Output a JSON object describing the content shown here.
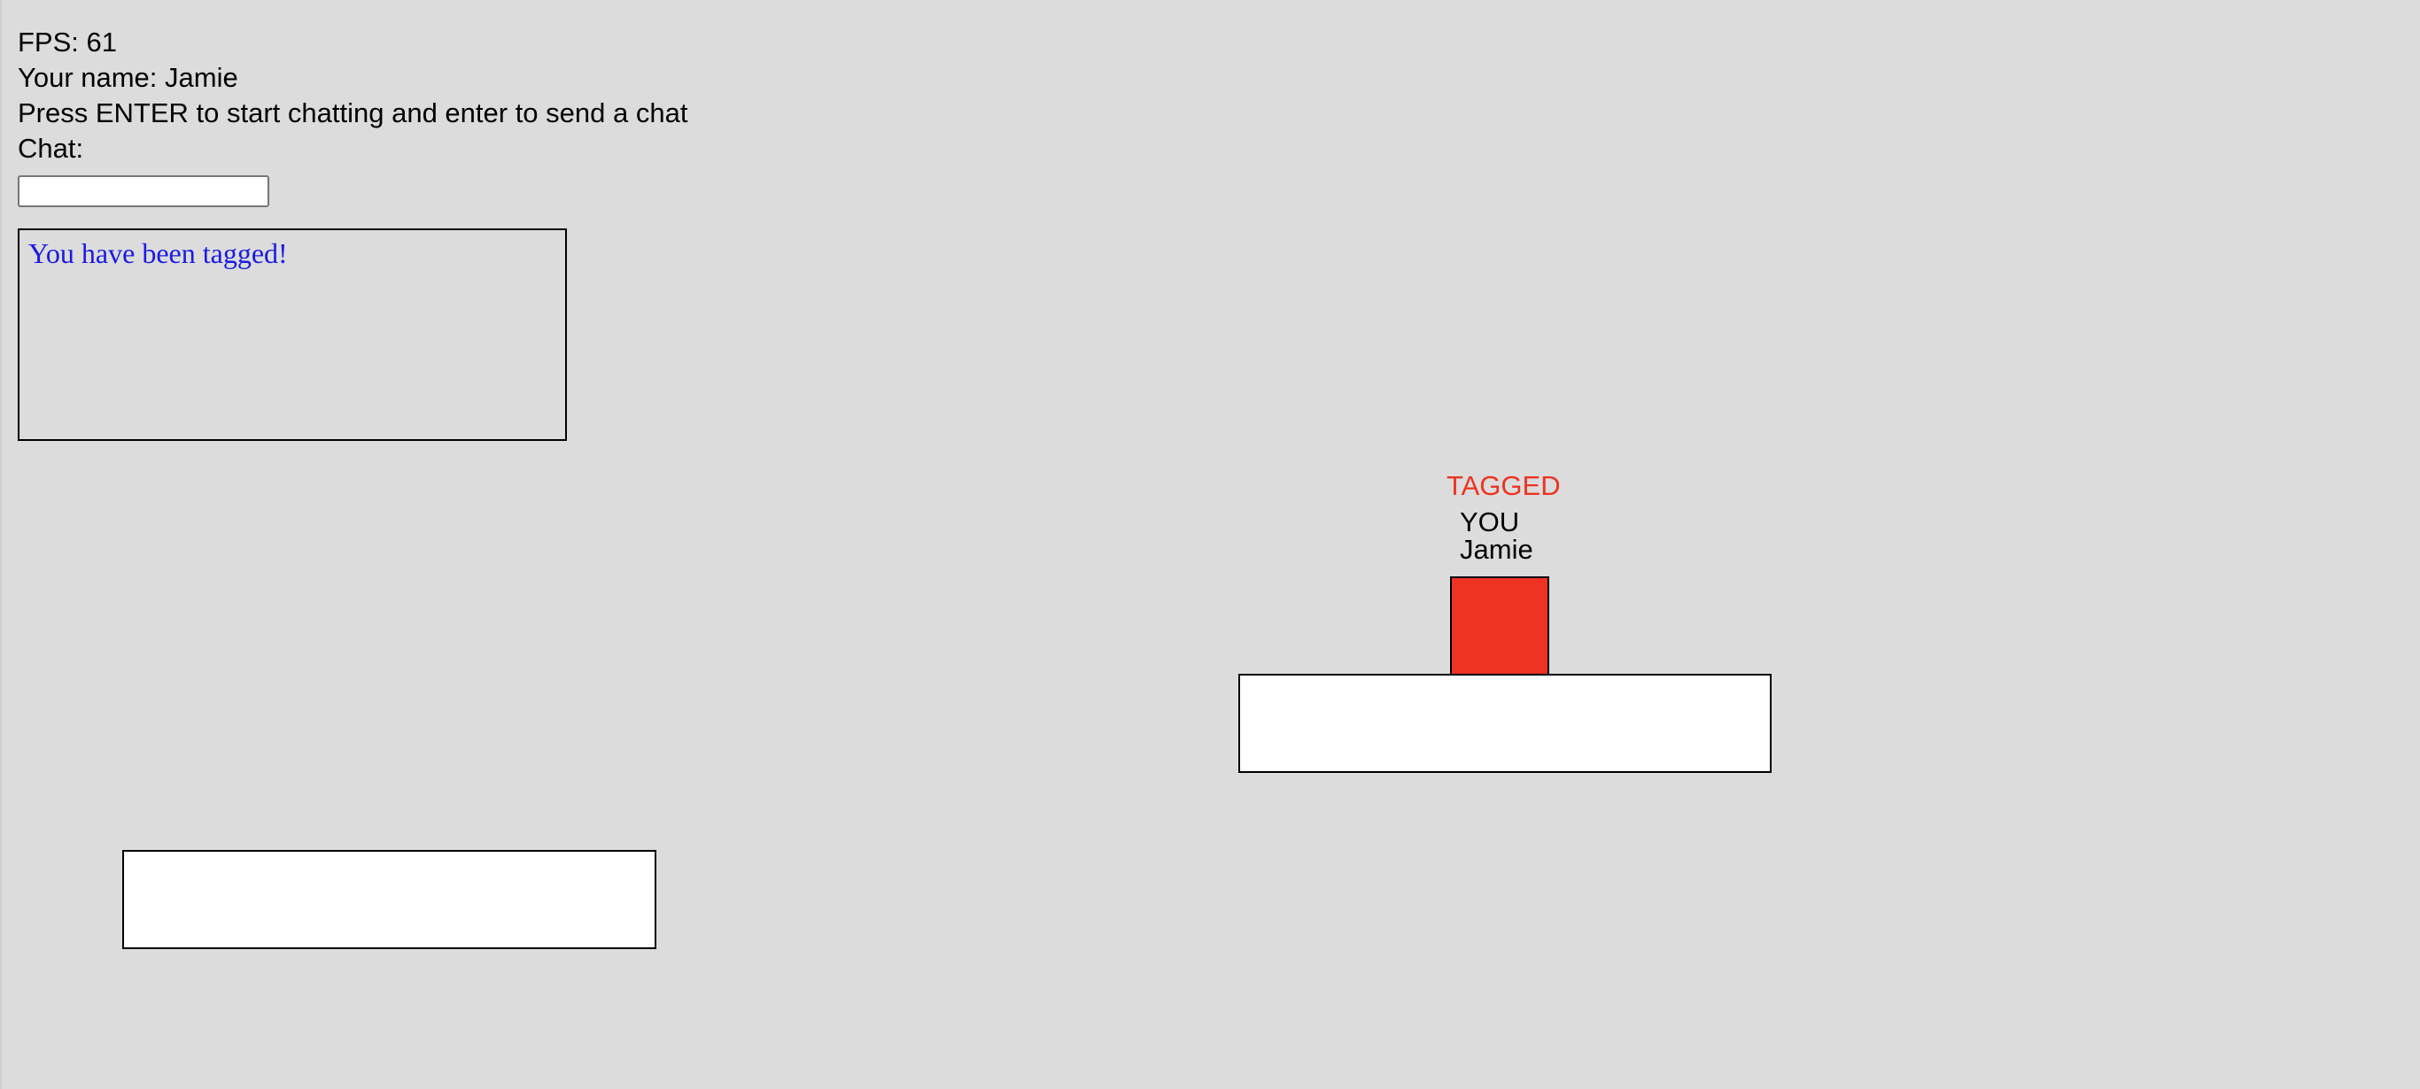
{
  "hud": {
    "fps_text": "FPS: 61",
    "name_text": "Your name: Jamie",
    "instructions": "Press ENTER to start chatting and enter to send a chat",
    "chat_label": "Chat:"
  },
  "chat": {
    "input_value": "",
    "messages": [
      "You have been tagged!"
    ],
    "message_color": "#1a1ae6"
  },
  "player": {
    "status": "TAGGED",
    "you_label": "YOU",
    "name": "Jamie",
    "color": "#ee3322"
  },
  "colors": {
    "background": "#dcdcdc",
    "platform": "#ffffff",
    "tagged_text": "#ee3322"
  }
}
